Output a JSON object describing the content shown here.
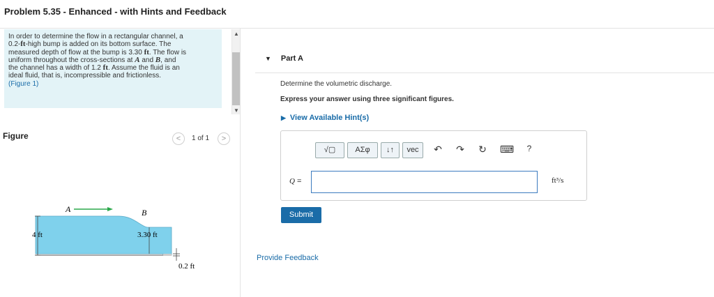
{
  "header": {
    "title": "Problem 5.35 - Enhanced - with Hints and Feedback"
  },
  "problem": {
    "t1": "In order to determine the flow in a rectangular channel, a",
    "t2": "0.2-",
    "t2b": "ft",
    "t2c": "-high bump is added on its bottom surface. The",
    "t3": "measured depth of flow at the bump is 3.30 ",
    "t3b": "ft",
    "t3c": ". The flow is",
    "t4": "uniform throughout the cross-sections at ",
    "t4a": "A",
    "t4b": " and ",
    "t4c": "B",
    "t4d": ", and",
    "t5": "the channel has a width of 1.2 ",
    "t5b": "ft",
    "t5c": ". Assume the fluid is an",
    "t6": "ideal fluid, that is, incompressible and frictionless.",
    "link": "(Figure 1)"
  },
  "figure": {
    "label": "Figure",
    "pager": "1 of 1",
    "prev": "<",
    "next": ">",
    "labelA": "A",
    "labelB": "B",
    "depth": "4 ft",
    "bumpdepth": "3.30 ft",
    "bump": "0.2 ft"
  },
  "part": {
    "title": "Part A",
    "question": "Determine the volumetric discharge.",
    "instruction": "Express your answer using three significant figures.",
    "hint": "View Available Hint(s)",
    "toolbar": {
      "sqrt": "√▢",
      "greek": "ΑΣφ",
      "arrows": "↓↑",
      "vec": "vec",
      "undo": "↶",
      "redo": "↷",
      "reset": "↻",
      "keyboard": "⌨",
      "help": "?"
    },
    "q_label": "Q",
    "eq": " =",
    "input_value": "",
    "unit": "ft³/s",
    "submit": "Submit"
  },
  "footer": {
    "feedback": "Provide Feedback"
  },
  "colors": {
    "accent": "#1a6ca8",
    "water": "#7fd1ec",
    "panel": "#e3f3f7",
    "arrow": "#2aa84a"
  }
}
